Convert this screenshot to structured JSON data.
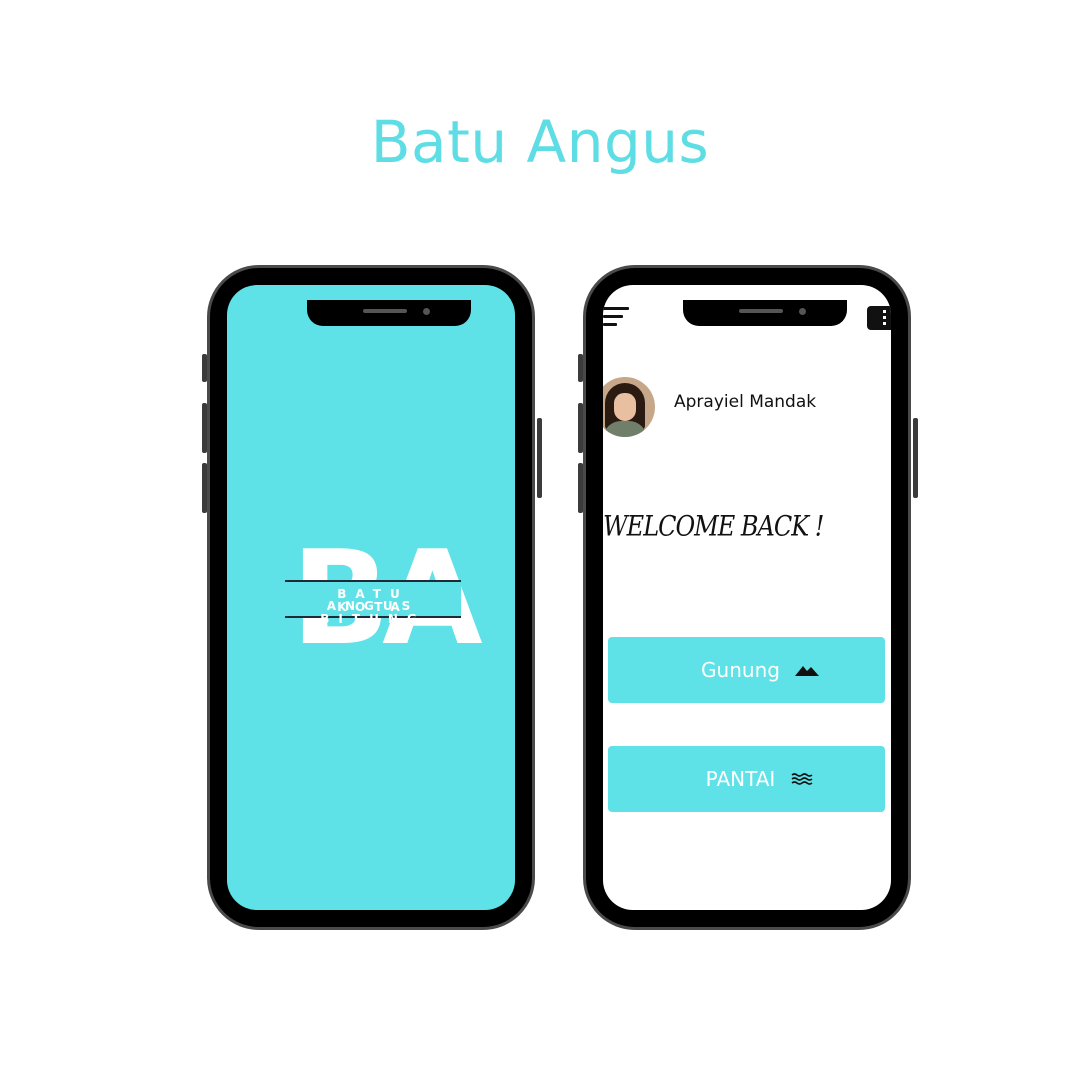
{
  "page": {
    "title": "Batu Angus"
  },
  "splash": {
    "logo_letters": "BA",
    "logo_line1": "BATU ANGUS",
    "logo_line2": "KOTA BITUNG"
  },
  "home": {
    "user_name": "Aprayiel Mandak",
    "welcome": "WELCOME BACK !",
    "categories": [
      {
        "label": "Gunung",
        "icon": "mountain-icon"
      },
      {
        "label": "PANTAI",
        "icon": "waves-icon"
      }
    ]
  },
  "colors": {
    "accent": "#5fe2e7",
    "title": "#5fdde4",
    "frame": "#000000",
    "text": "#111111"
  }
}
